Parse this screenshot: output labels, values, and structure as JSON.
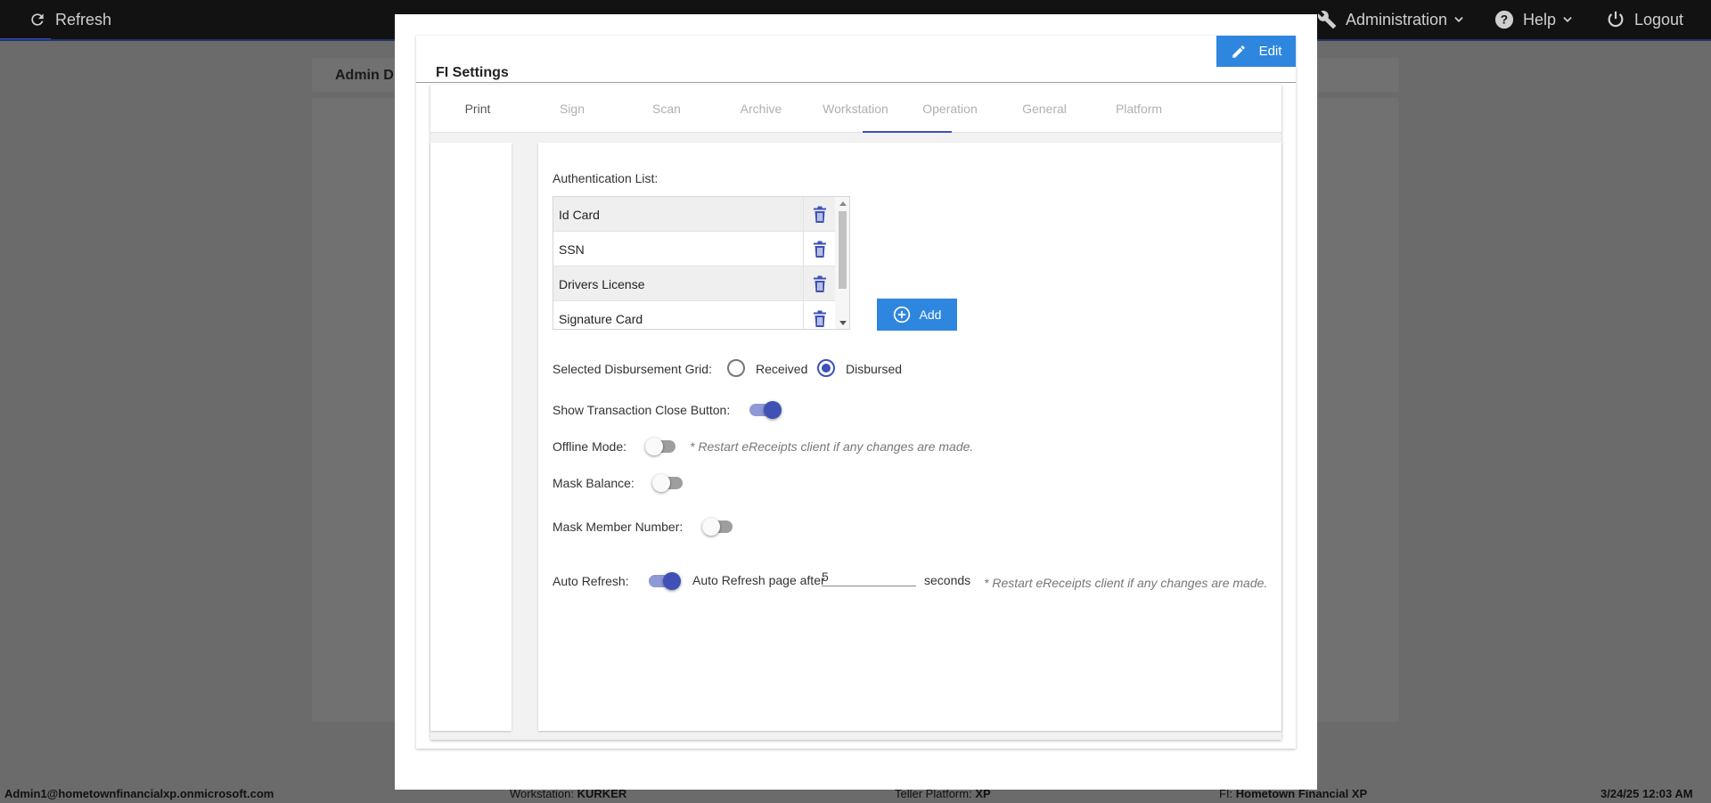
{
  "topbar": {
    "refresh": "Refresh",
    "administration": "Administration",
    "help": "Help",
    "logout": "Logout"
  },
  "background": {
    "header_title": "Admin D"
  },
  "footer": {
    "user": "Admin1@hometownfinancialxp.onmicrosoft.com",
    "workstation_label": "Workstation:",
    "workstation_value": "KURKER",
    "platform_label": "Teller Platform:",
    "platform_value": "XP",
    "fi_label": "FI:",
    "fi_value": "Hometown Financial XP",
    "datetime": "3/24/25 12:03 AM"
  },
  "modal": {
    "title": "FI Settings",
    "edit_label": "Edit",
    "tabs": [
      {
        "label": "Print"
      },
      {
        "label": "Sign"
      },
      {
        "label": "Scan"
      },
      {
        "label": "Archive"
      },
      {
        "label": "Workstation"
      },
      {
        "label": "Operation"
      },
      {
        "label": "General"
      },
      {
        "label": "Platform"
      }
    ],
    "active_tab": "Operation",
    "auth_list_label": "Authentication List:",
    "auth_items": [
      {
        "name": "Id Card"
      },
      {
        "name": "SSN"
      },
      {
        "name": "Drivers License"
      },
      {
        "name": "Signature Card"
      }
    ],
    "add_label": "Add",
    "disbursement_label": "Selected Disbursement Grid:",
    "disbursement_options": [
      "Received",
      "Disbursed"
    ],
    "disbursement_selected": "Disbursed",
    "show_close_label": "Show Transaction Close Button:",
    "show_close_on": true,
    "offline_label": "Offline Mode:",
    "offline_on": false,
    "restart_note": "* Restart eReceipts client if any changes are made.",
    "mask_balance_label": "Mask Balance:",
    "mask_balance_on": false,
    "mask_member_label": "Mask Member Number:",
    "mask_member_on": false,
    "auto_refresh_label": "Auto Refresh:",
    "auto_refresh_on": true,
    "auto_refresh_after": "Auto Refresh page after",
    "auto_refresh_value": "5",
    "seconds_label": "seconds"
  },
  "colors": {
    "primary_button": "#2f86de",
    "accent": "#3f51b5",
    "backdrop": "#6b6b6b"
  }
}
